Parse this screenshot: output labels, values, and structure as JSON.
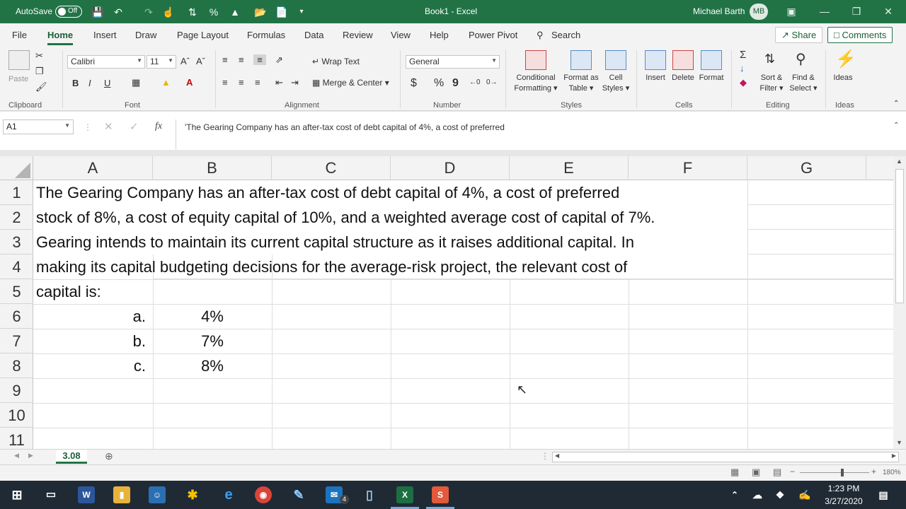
{
  "titlebar": {
    "autosave_label": "AutoSave",
    "autosave_state": "Off",
    "window_title": "Book1  -  Excel",
    "user_name": "Michael Barth",
    "user_initials": "MB"
  },
  "tabs": [
    "File",
    "Home",
    "Insert",
    "Draw",
    "Page Layout",
    "Formulas",
    "Data",
    "Review",
    "View",
    "Help",
    "Power Pivot"
  ],
  "active_tab": "Home",
  "search_label": "Search",
  "share_label": "Share",
  "comments_label": "Comments",
  "ribbon": {
    "clipboard": {
      "paste": "Paste",
      "group": "Clipboard"
    },
    "font": {
      "name": "Calibri",
      "size": "11",
      "bold": "B",
      "italic": "I",
      "underline": "U",
      "group": "Font"
    },
    "alignment": {
      "wrap": "Wrap Text",
      "merge": "Merge & Center",
      "group": "Alignment"
    },
    "number": {
      "format": "General",
      "currency": "$",
      "percent": "%",
      "comma": "9",
      "group": "Number"
    },
    "styles": {
      "conditional": "Conditional",
      "conditional2": "Formatting",
      "format_as": "Format as",
      "format_as2": "Table",
      "cell": "Cell",
      "cell2": "Styles",
      "group": "Styles"
    },
    "cells": {
      "insert": "Insert",
      "delete": "Delete",
      "format": "Format",
      "group": "Cells"
    },
    "editing": {
      "sort": "Sort &",
      "sort2": "Filter",
      "find": "Find &",
      "find2": "Select",
      "group": "Editing"
    },
    "ideas": {
      "label": "Ideas",
      "group": "Ideas"
    }
  },
  "formula_bar": {
    "name_box": "A1",
    "fx": "fx",
    "content": "'The Gearing Company has an after-tax cost of debt capital of 4%, a cost of preferred"
  },
  "columns": [
    "A",
    "B",
    "C",
    "D",
    "E",
    "F",
    "G"
  ],
  "rows": [
    "1",
    "2",
    "3",
    "4",
    "5",
    "6",
    "7",
    "8",
    "9",
    "10",
    "11"
  ],
  "cells": {
    "A1": "The Gearing Company has an after-tax cost of debt capital of 4%, a cost of preferred",
    "A2": "stock of 8%, a cost of equity capital of 10%, and a weighted average cost of capital of 7%.",
    "A3": "Gearing intends to maintain its current capital structure as it raises additional capital. In",
    "A4": "making its capital budgeting decisions for the average-risk project, the relevant cost of",
    "A5": "capital is:",
    "A6": "a.",
    "B6": "4%",
    "A7": "b.",
    "B7": "7%",
    "A8": "c.",
    "B8": "8%"
  },
  "sheet_tab": "3.08",
  "zoom": "180%",
  "taskbar": {
    "time": "1:23 PM",
    "date": "3/27/2020",
    "mail_badge": "4"
  }
}
